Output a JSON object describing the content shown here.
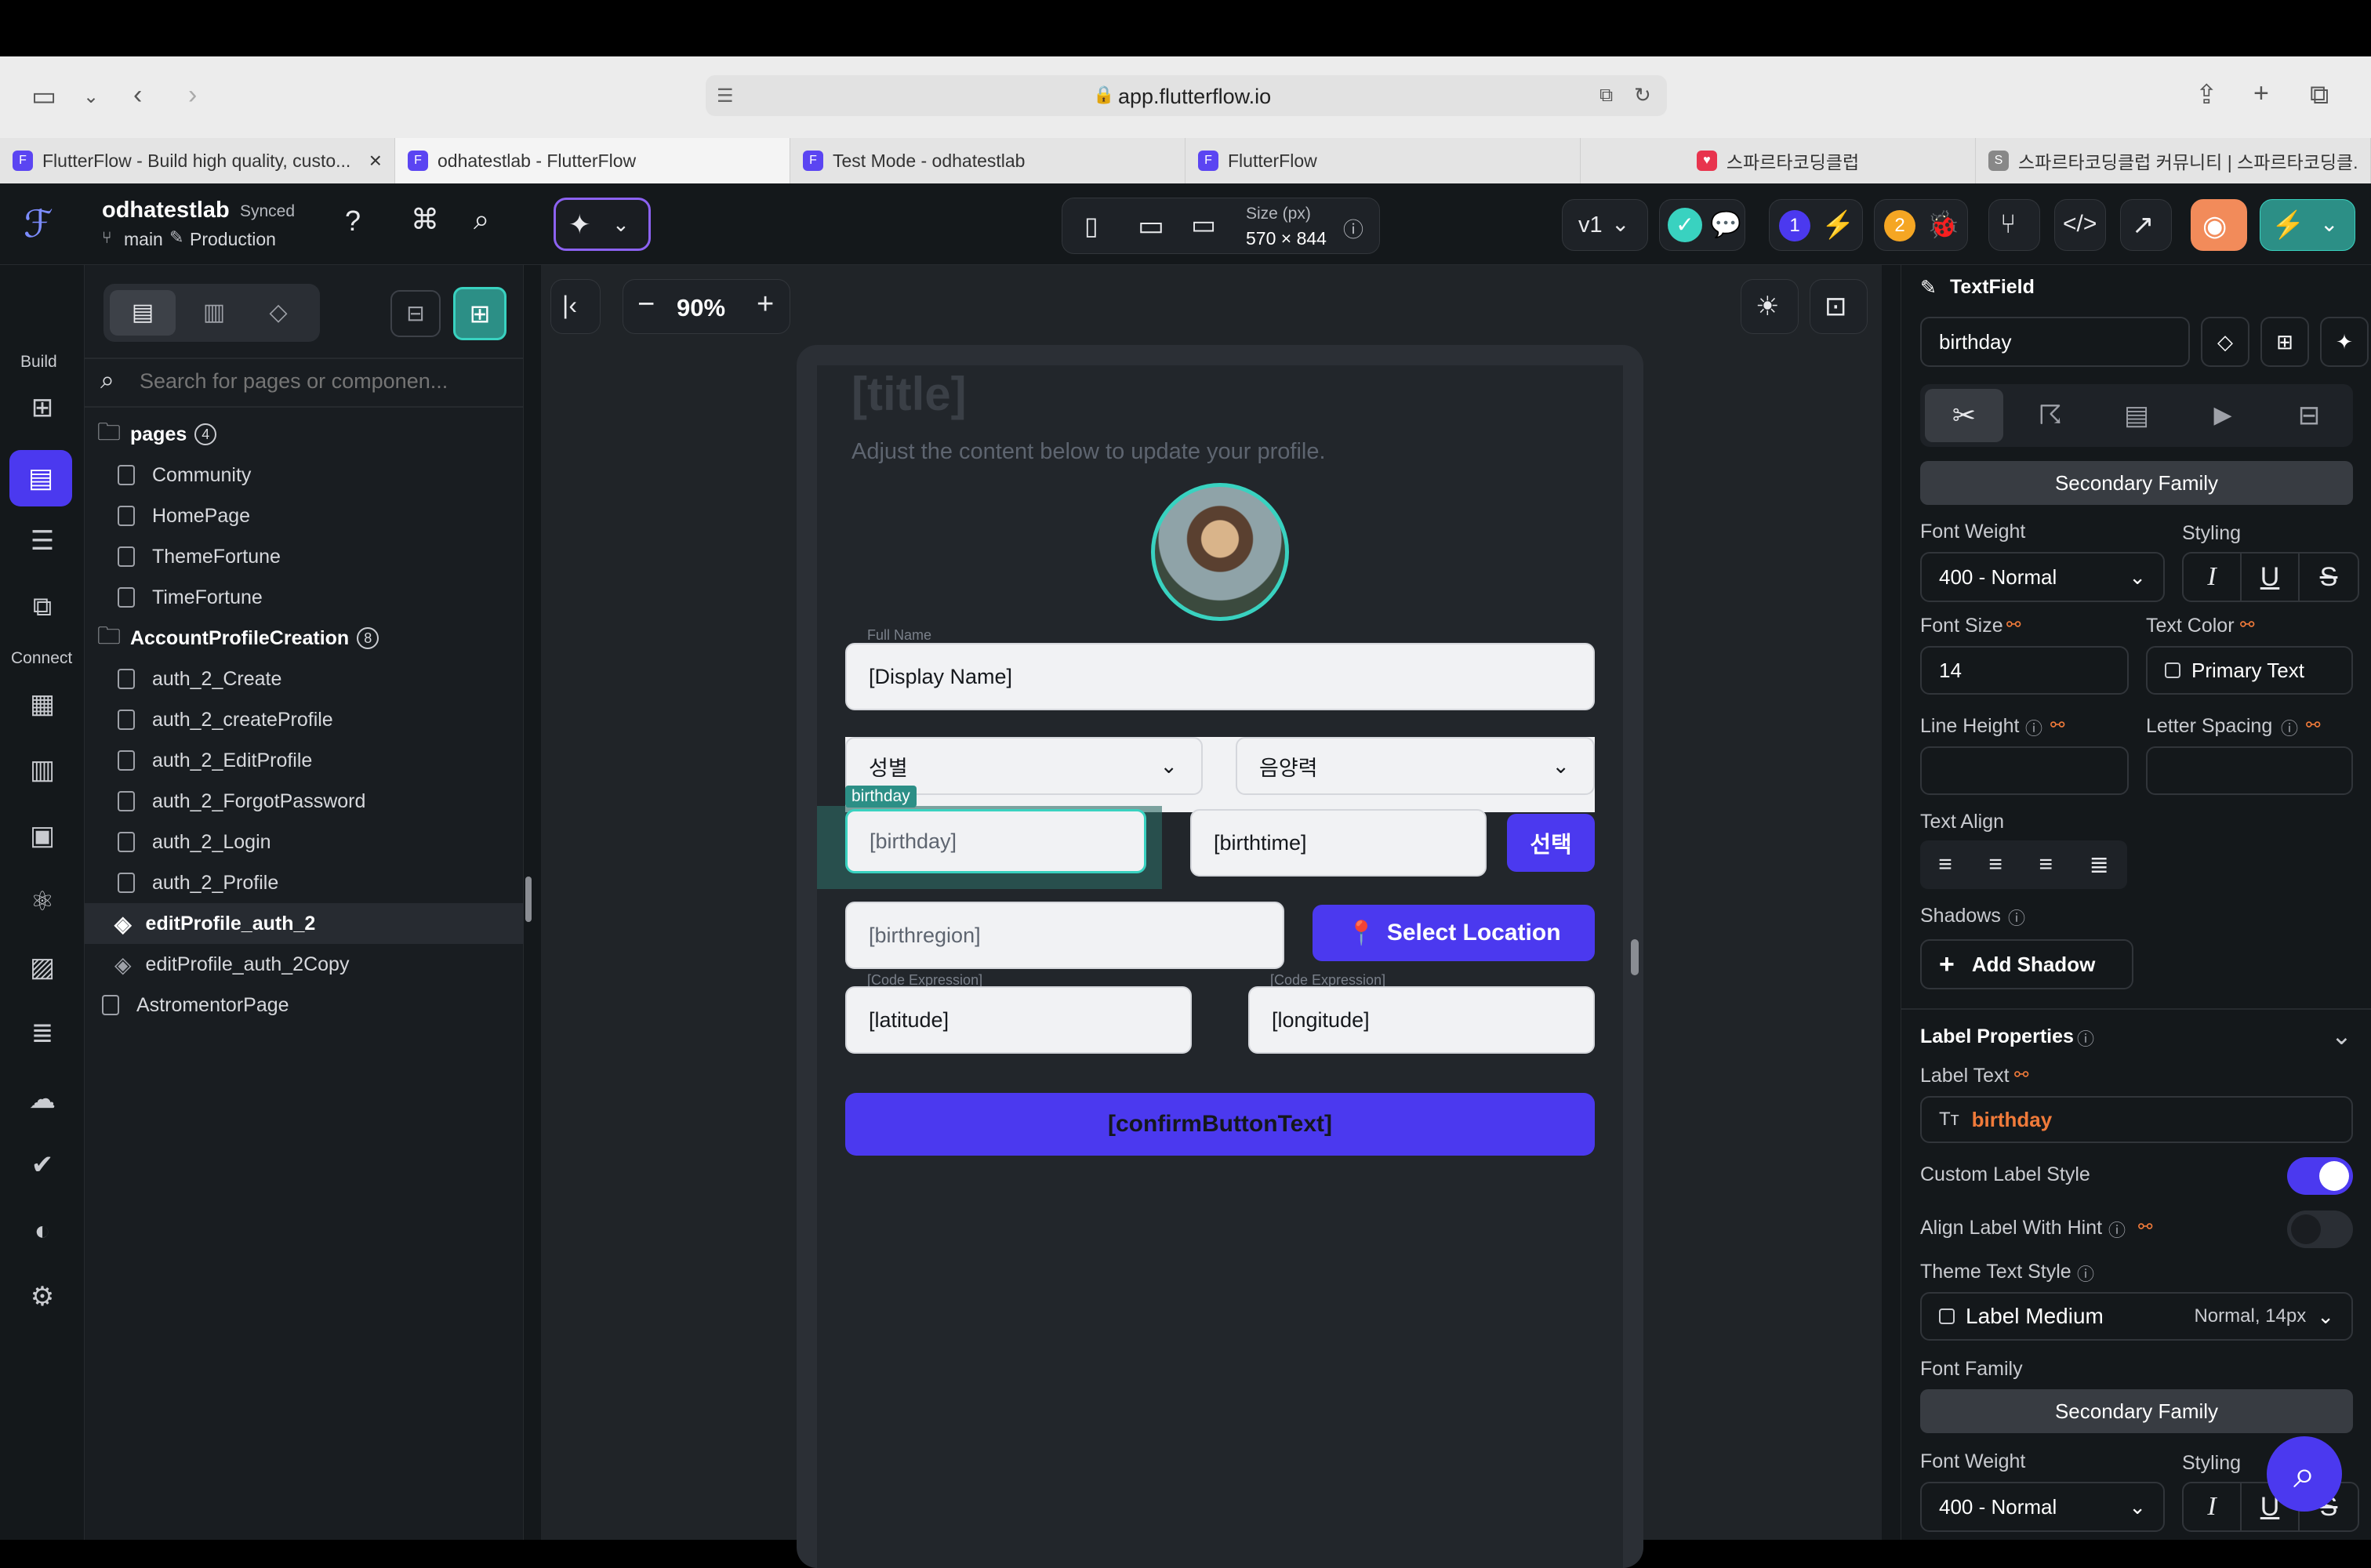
{
  "browser": {
    "url": "app.flutterflow.io",
    "tabs": [
      {
        "title": "FlutterFlow - Build high quality, custo...",
        "close": "×"
      },
      {
        "title": "odhatestlab - FlutterFlow"
      },
      {
        "title": "Test Mode - odhatestlab"
      },
      {
        "title": "FlutterFlow"
      },
      {
        "title": "스파르타코딩클럽"
      },
      {
        "title": "스파르타코딩클럽 커뮤니티 | 스파르타코딩클..."
      }
    ]
  },
  "topbar": {
    "project_name": "odhatestlab",
    "sync_status": "Synced",
    "branch": "main",
    "environment": "Production",
    "device_size_label": "Size (px)",
    "device_size": "570 × 844",
    "version": "v1",
    "badge_one": "1",
    "badge_two": "2"
  },
  "rail": {
    "build_label": "Build",
    "connect_label": "Connect"
  },
  "pages_panel": {
    "search_placeholder": "Search for pages or componen...",
    "pages_folder": "pages",
    "pages_count": "4",
    "pages": [
      "Community",
      "HomePage",
      "ThemeFortune",
      "TimeFortune"
    ],
    "account_folder": "AccountProfileCreation",
    "account_count": "8",
    "account_pages": [
      "auth_2_Create",
      "auth_2_createProfile",
      "auth_2_EditProfile",
      "auth_2_ForgotPassword",
      "auth_2_Login",
      "auth_2_Profile",
      "editProfile_auth_2",
      "editProfile_auth_2Copy"
    ],
    "selected_page": "editProfile_auth_2",
    "bottom_page": "AstromentorPage"
  },
  "canvas": {
    "zoom": "90%",
    "title": "[title]",
    "subtitle": "Adjust the content below to update your profile.",
    "full_name_label": "Full Name",
    "display_name": "[Display Name]",
    "gender_dropdown": "성별",
    "calendar_dropdown": "음양력",
    "selected_chip": "birthday",
    "birthday": "[birthday]",
    "birthtime": "[birthtime]",
    "select_button": "선택",
    "birthregion": "[birthregion]",
    "select_location": "Select Location",
    "code_expression_1": "[Code Expression]",
    "latitude": "[latitude]",
    "code_expression_2": "[Code Expression]",
    "longitude": "[longitude]",
    "confirm_button": "[confirmButtonText]"
  },
  "properties": {
    "widget_type": "TextField",
    "widget_name": "birthday",
    "font_family_btn": "Secondary Family",
    "font_weight_label": "Font Weight",
    "font_weight": "400 - Normal",
    "styling_label": "Styling",
    "font_size_label": "Font Size",
    "font_size": "14",
    "text_color_label": "Text Color",
    "text_color": "Primary Text",
    "line_height_label": "Line Height",
    "letter_spacing_label": "Letter Spacing",
    "text_align_label": "Text Align",
    "shadows_label": "Shadows",
    "add_shadow": "Add Shadow",
    "label_properties": "Label Properties",
    "label_text_label": "Label Text",
    "label_text": "birthday",
    "custom_label_style": "Custom Label Style",
    "align_label_hint": "Align Label With Hint",
    "theme_text_style_label": "Theme Text Style",
    "theme_text_style": "Label Medium",
    "theme_text_style_detail": "Normal, 14px",
    "font_family_label": "Font Family",
    "font_family_btn_2": "Secondary Family",
    "font_weight_label_2": "Font Weight",
    "font_weight_2": "400 - Normal",
    "styling_label_2": "Styling"
  },
  "colors": {
    "accent": "#4b39ef",
    "teal": "#39d2c0",
    "orange": "#f07a3a"
  }
}
